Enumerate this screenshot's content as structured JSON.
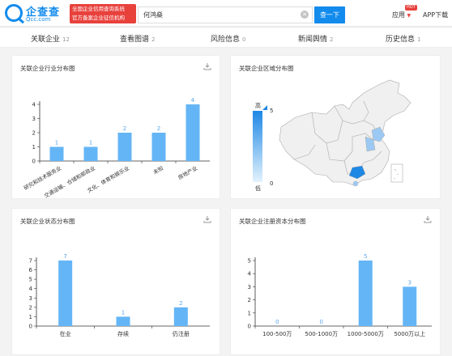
{
  "header": {
    "logo_cn": "企查查",
    "logo_en": "Qcc.com",
    "badge_line1": "全国企业信用查询系统",
    "badge_line2": "官方备案企业征信机构",
    "search_value": "何鸿燊",
    "search_button": "查一下",
    "app_menu": "应用",
    "hot_tag": "HOT",
    "app_download": "APP下载"
  },
  "tabs": [
    {
      "label": "关联企业",
      "count": "12"
    },
    {
      "label": "查看图谱",
      "count": "2"
    },
    {
      "label": "风险信息",
      "count": "0"
    },
    {
      "label": "新闻舆情",
      "count": "2"
    },
    {
      "label": "历史信息",
      "count": "1"
    }
  ],
  "cards": {
    "industry_title": "关联企业行业分布图",
    "region_title": "关联企业区域分布图",
    "status_title": "关联企业状态分布图",
    "capital_title": "关联企业注册资本分布图"
  },
  "map": {
    "legend_high": "高",
    "legend_low": "低",
    "legend_max": "5",
    "legend_min": "0",
    "colors": {
      "high": "#1e88e5",
      "low": "#e3f2fd",
      "region_fill": "#f0f0f0",
      "highlight_mid": "#9cc9f3"
    }
  },
  "chart_data": [
    {
      "type": "bar",
      "title": "关联企业行业分布图",
      "categories": [
        "研究和技术服务业",
        "交通运输、仓储和邮政业",
        "文化、体育和娱乐业",
        "未知",
        "房地产业"
      ],
      "values": [
        1,
        1,
        2,
        2,
        4
      ],
      "ylim": [
        0,
        4
      ],
      "yticks": [
        "0",
        "1",
        "2",
        "3",
        "4"
      ],
      "xlabel": "",
      "ylabel": "",
      "color": "#64b5f6"
    },
    {
      "type": "bar",
      "title": "关联企业状态分布图",
      "categories": [
        "在业",
        "存续",
        "仍注册"
      ],
      "values": [
        7,
        1,
        2
      ],
      "ylim": [
        0,
        7
      ],
      "yticks": [
        "0",
        "1",
        "2",
        "3",
        "4",
        "5",
        "6",
        "7"
      ],
      "xlabel": "",
      "ylabel": "",
      "color": "#64b5f6"
    },
    {
      "type": "bar",
      "title": "关联企业注册资本分布图",
      "categories": [
        "100-500万",
        "500-1000万",
        "1000-5000万",
        "5000万以上"
      ],
      "values": [
        0,
        0,
        5,
        3
      ],
      "ylim": [
        0,
        5
      ],
      "yticks": [
        "0",
        "1",
        "2",
        "3",
        "4",
        "5"
      ],
      "xlabel": "",
      "ylabel": "",
      "color": "#64b5f6"
    }
  ]
}
